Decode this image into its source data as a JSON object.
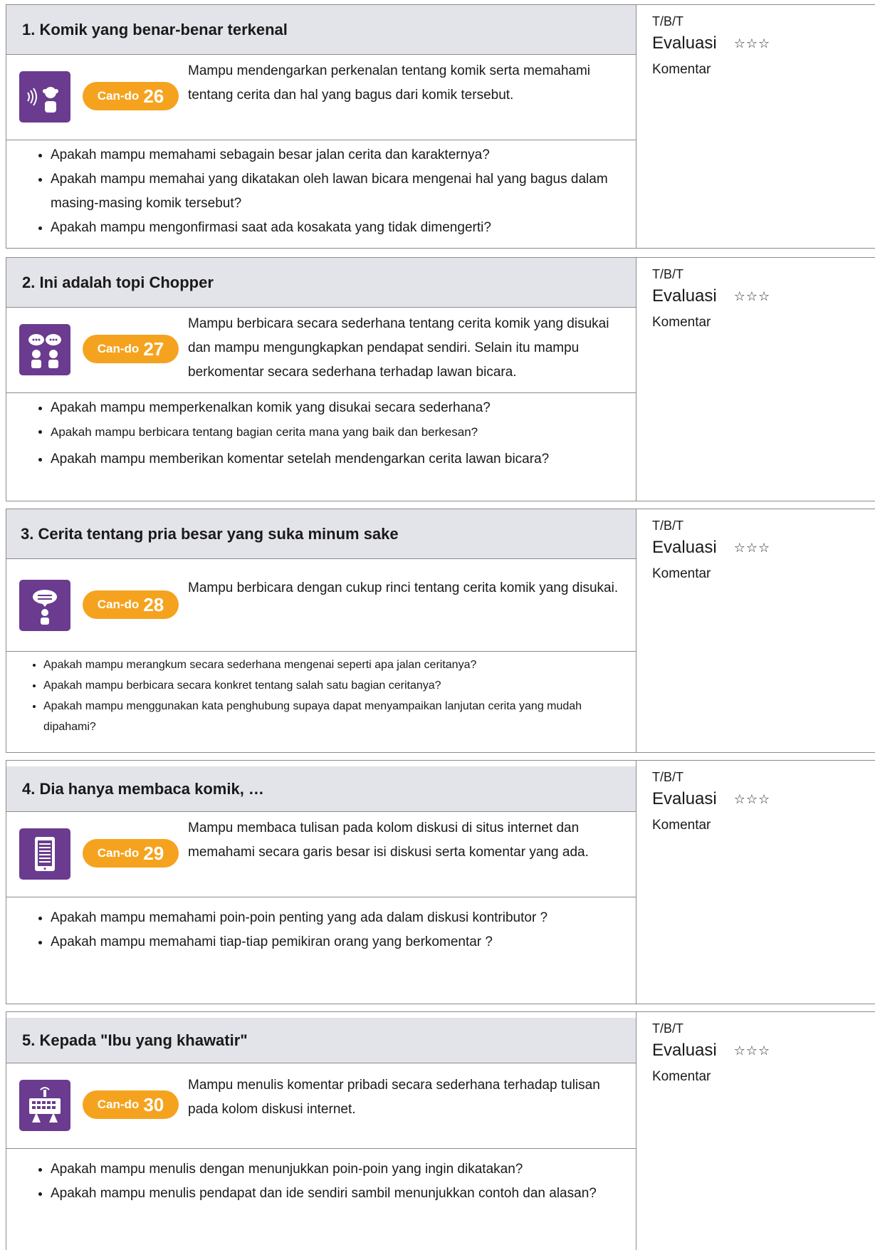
{
  "cards": [
    {
      "title": "1. Komik yang benar-benar terkenal",
      "icon": "listening-icon",
      "can_do_label": "Can-do",
      "can_do_number": "26",
      "description": "Mampu mendengarkan perkenalan tentang komik serta memahami tentang cerita dan hal yang bagus dari  komik tersebut.",
      "checks": [
        "Apakah mampu memahami sebagain besar jalan cerita dan karakternya?",
        "Apakah mampu memahai yang dikatakan oleh lawan bicara mengenai hal yang bagus dalam masing-masing komik tersebut?",
        "Apakah mampu mengonfirmasi saat ada kosakata yang tidak dimengerti?"
      ],
      "tbt": "T/B/T",
      "evaluasi": "Evaluasi",
      "stars": "☆☆☆",
      "komentar": "Komentar"
    },
    {
      "title": "2. Ini adalah topi Chopper",
      "icon": "conversation-icon",
      "can_do_label": "Can-do",
      "can_do_number": "27",
      "description": "Mampu berbicara secara sederhana tentang cerita komik yang disukai dan mampu mengungkapkan pendapat sendiri. Selain itu mampu berkomentar secara sederhana terhadap lawan bicara.",
      "checks": [
        "Apakah mampu memperkenalkan komik yang disukai secara sederhana?",
        "Apakah mampu berbicara tentang bagian cerita mana yang baik dan berkesan?",
        "Apakah mampu memberikan komentar setelah mendengarkan cerita lawan bicara?"
      ],
      "tbt": "T/B/T",
      "evaluasi": "Evaluasi",
      "stars": "☆☆☆",
      "komentar": "Komentar"
    },
    {
      "title": "3. Cerita tentang pria besar yang suka minum sake",
      "icon": "speaking-icon",
      "can_do_label": "Can-do",
      "can_do_number": "28",
      "description": "Mampu berbicara dengan cukup rinci tentang cerita komik yang disukai.",
      "checks": [
        "Apakah mampu merangkum secara sederhana mengenai seperti apa jalan ceritanya?",
        "Apakah mampu berbicara secara konkret tentang salah satu bagian ceritanya?",
        "Apakah mampu menggunakan kata penghubung supaya dapat menyampaikan lanjutan cerita yang mudah dipahami?"
      ],
      "tbt": "T/B/T",
      "evaluasi": "Evaluasi",
      "stars": "☆☆☆",
      "komentar": "Komentar"
    },
    {
      "title": "4. Dia hanya membaca komik, …",
      "icon": "reading-icon",
      "can_do_label": "Can-do",
      "can_do_number": "29",
      "description": "Mampu membaca tulisan pada kolom diskusi di situs internet dan memahami secara garis besar isi diskusi serta komentar yang ada.",
      "checks": [
        "Apakah mampu memahami poin-poin penting yang ada dalam diskusi kontributor ?",
        "Apakah mampu memahami tiap-tiap pemikiran orang yang berkomentar ?"
      ],
      "tbt": "T/B/T",
      "evaluasi": "Evaluasi",
      "stars": "☆☆☆",
      "komentar": "Komentar"
    },
    {
      "title": "5. Kepada \"Ibu yang khawatir\"",
      "icon": "writing-icon",
      "can_do_label": "Can-do",
      "can_do_number": "30",
      "description": "Mampu menulis komentar pribadi secara sederhana terhadap tulisan pada kolom diskusi internet.",
      "checks": [
        "Apakah mampu menulis dengan menunjukkan poin-poin yang ingin dikatakan?",
        "Apakah mampu menulis pendapat dan ide sendiri sambil menunjukkan contoh dan alasan?"
      ],
      "tbt": "T/B/T",
      "evaluasi": "Evaluasi",
      "stars": "☆☆☆",
      "komentar": "Komentar"
    }
  ]
}
